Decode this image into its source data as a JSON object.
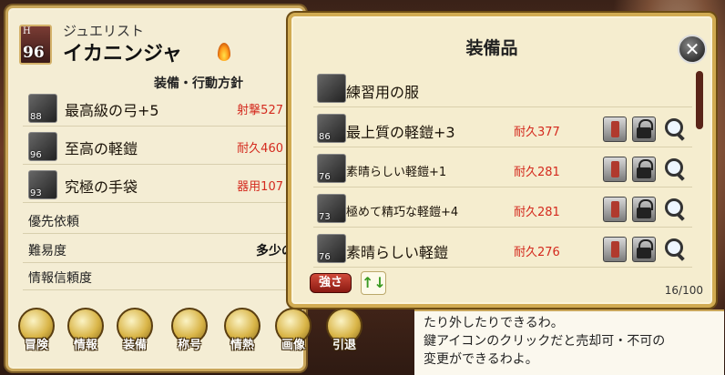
{
  "character": {
    "level_prefix": "H",
    "level": "96",
    "class_name": "ジュエリスト",
    "name": "イカニンジャ",
    "section_title": "装備・行動方針"
  },
  "equipped": [
    {
      "level": "88",
      "name": "最高級の弓+5",
      "stat": "射撃527"
    },
    {
      "level": "96",
      "name": "至高の軽鎧",
      "stat": "耐久460"
    },
    {
      "level": "93",
      "name": "究極の手袋",
      "stat": "器用107"
    }
  ],
  "info_rows": [
    {
      "label": "優先依頼",
      "value": ""
    },
    {
      "label": "難易度",
      "value": "多少の"
    },
    {
      "label": "情報信頼度",
      "value": ""
    }
  ],
  "commands": [
    {
      "label": "冒険",
      "icon": "sword-icon"
    },
    {
      "label": "情報",
      "icon": "orb-icon"
    },
    {
      "label": "装備",
      "icon": "equip-icon"
    },
    {
      "label": "称号",
      "icon": "medal-icon"
    },
    {
      "label": "情熱",
      "icon": "flame-icon"
    },
    {
      "label": "画像",
      "icon": "image-icon"
    },
    {
      "label": "引退",
      "icon": "exit-icon"
    }
  ],
  "dialog": {
    "lines": [
      "たり外したりできるわ。",
      "鍵アイコンのクリックだと売却可・不可の",
      "変更ができるわよ。"
    ]
  },
  "modal": {
    "title": "装備品",
    "close_icon": "close-icon",
    "sort_label": "強さ",
    "order_icon": "↑↓",
    "count": "16/100",
    "items": [
      {
        "level": "",
        "name": "練習用の服",
        "stat": "",
        "small": false,
        "actions": false
      },
      {
        "level": "86",
        "name": "最上質の軽鎧+3",
        "stat": "耐久377",
        "small": false,
        "actions": true
      },
      {
        "level": "76",
        "name": "素晴らしい軽鎧+1",
        "stat": "耐久281",
        "small": true,
        "actions": true
      },
      {
        "level": "73",
        "name": "極めて精巧な軽鎧+4",
        "stat": "耐久281",
        "small": true,
        "actions": true
      },
      {
        "level": "76",
        "name": "素晴らしい軽鎧",
        "stat": "耐久276",
        "small": false,
        "actions": true
      }
    ]
  }
}
